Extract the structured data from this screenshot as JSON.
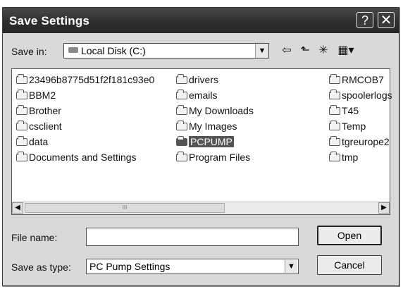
{
  "titlebar": {
    "title": "Save Settings",
    "help_glyph": "?",
    "close_glyph": "✕"
  },
  "toolbar": {
    "save_in_label": "Save in:",
    "location_value": "Local Disk (C:)",
    "location_icon": "drive-icon",
    "back_glyph": "⇦",
    "up_glyph": "⬑",
    "new_folder_glyph": "✳",
    "views_glyph": "▦▾"
  },
  "files": {
    "columns": [
      [
        "23496b8775d51f2f181c93e0",
        "BBM2",
        "Brother",
        "csclient",
        "data",
        "Documents and Settings"
      ],
      [
        "drivers",
        "emails",
        "My Downloads",
        "My Images",
        "PCPUMP",
        "Program Files"
      ],
      [
        "RMCOB7",
        "spoolerlogs",
        "T45",
        "Temp",
        "tgreurope2",
        "tmp"
      ]
    ],
    "selected": "PCPUMP"
  },
  "scrollbar": {
    "left_glyph": "◀",
    "right_glyph": "▶",
    "thumb_grip": "III"
  },
  "form": {
    "file_name_label": "File name:",
    "file_name_value": "",
    "save_as_type_label": "Save as type:",
    "save_as_type_value": "PC Pump Settings",
    "dropdown_glyph": "▼"
  },
  "buttons": {
    "open_label": "Open",
    "cancel_label": "Cancel"
  }
}
